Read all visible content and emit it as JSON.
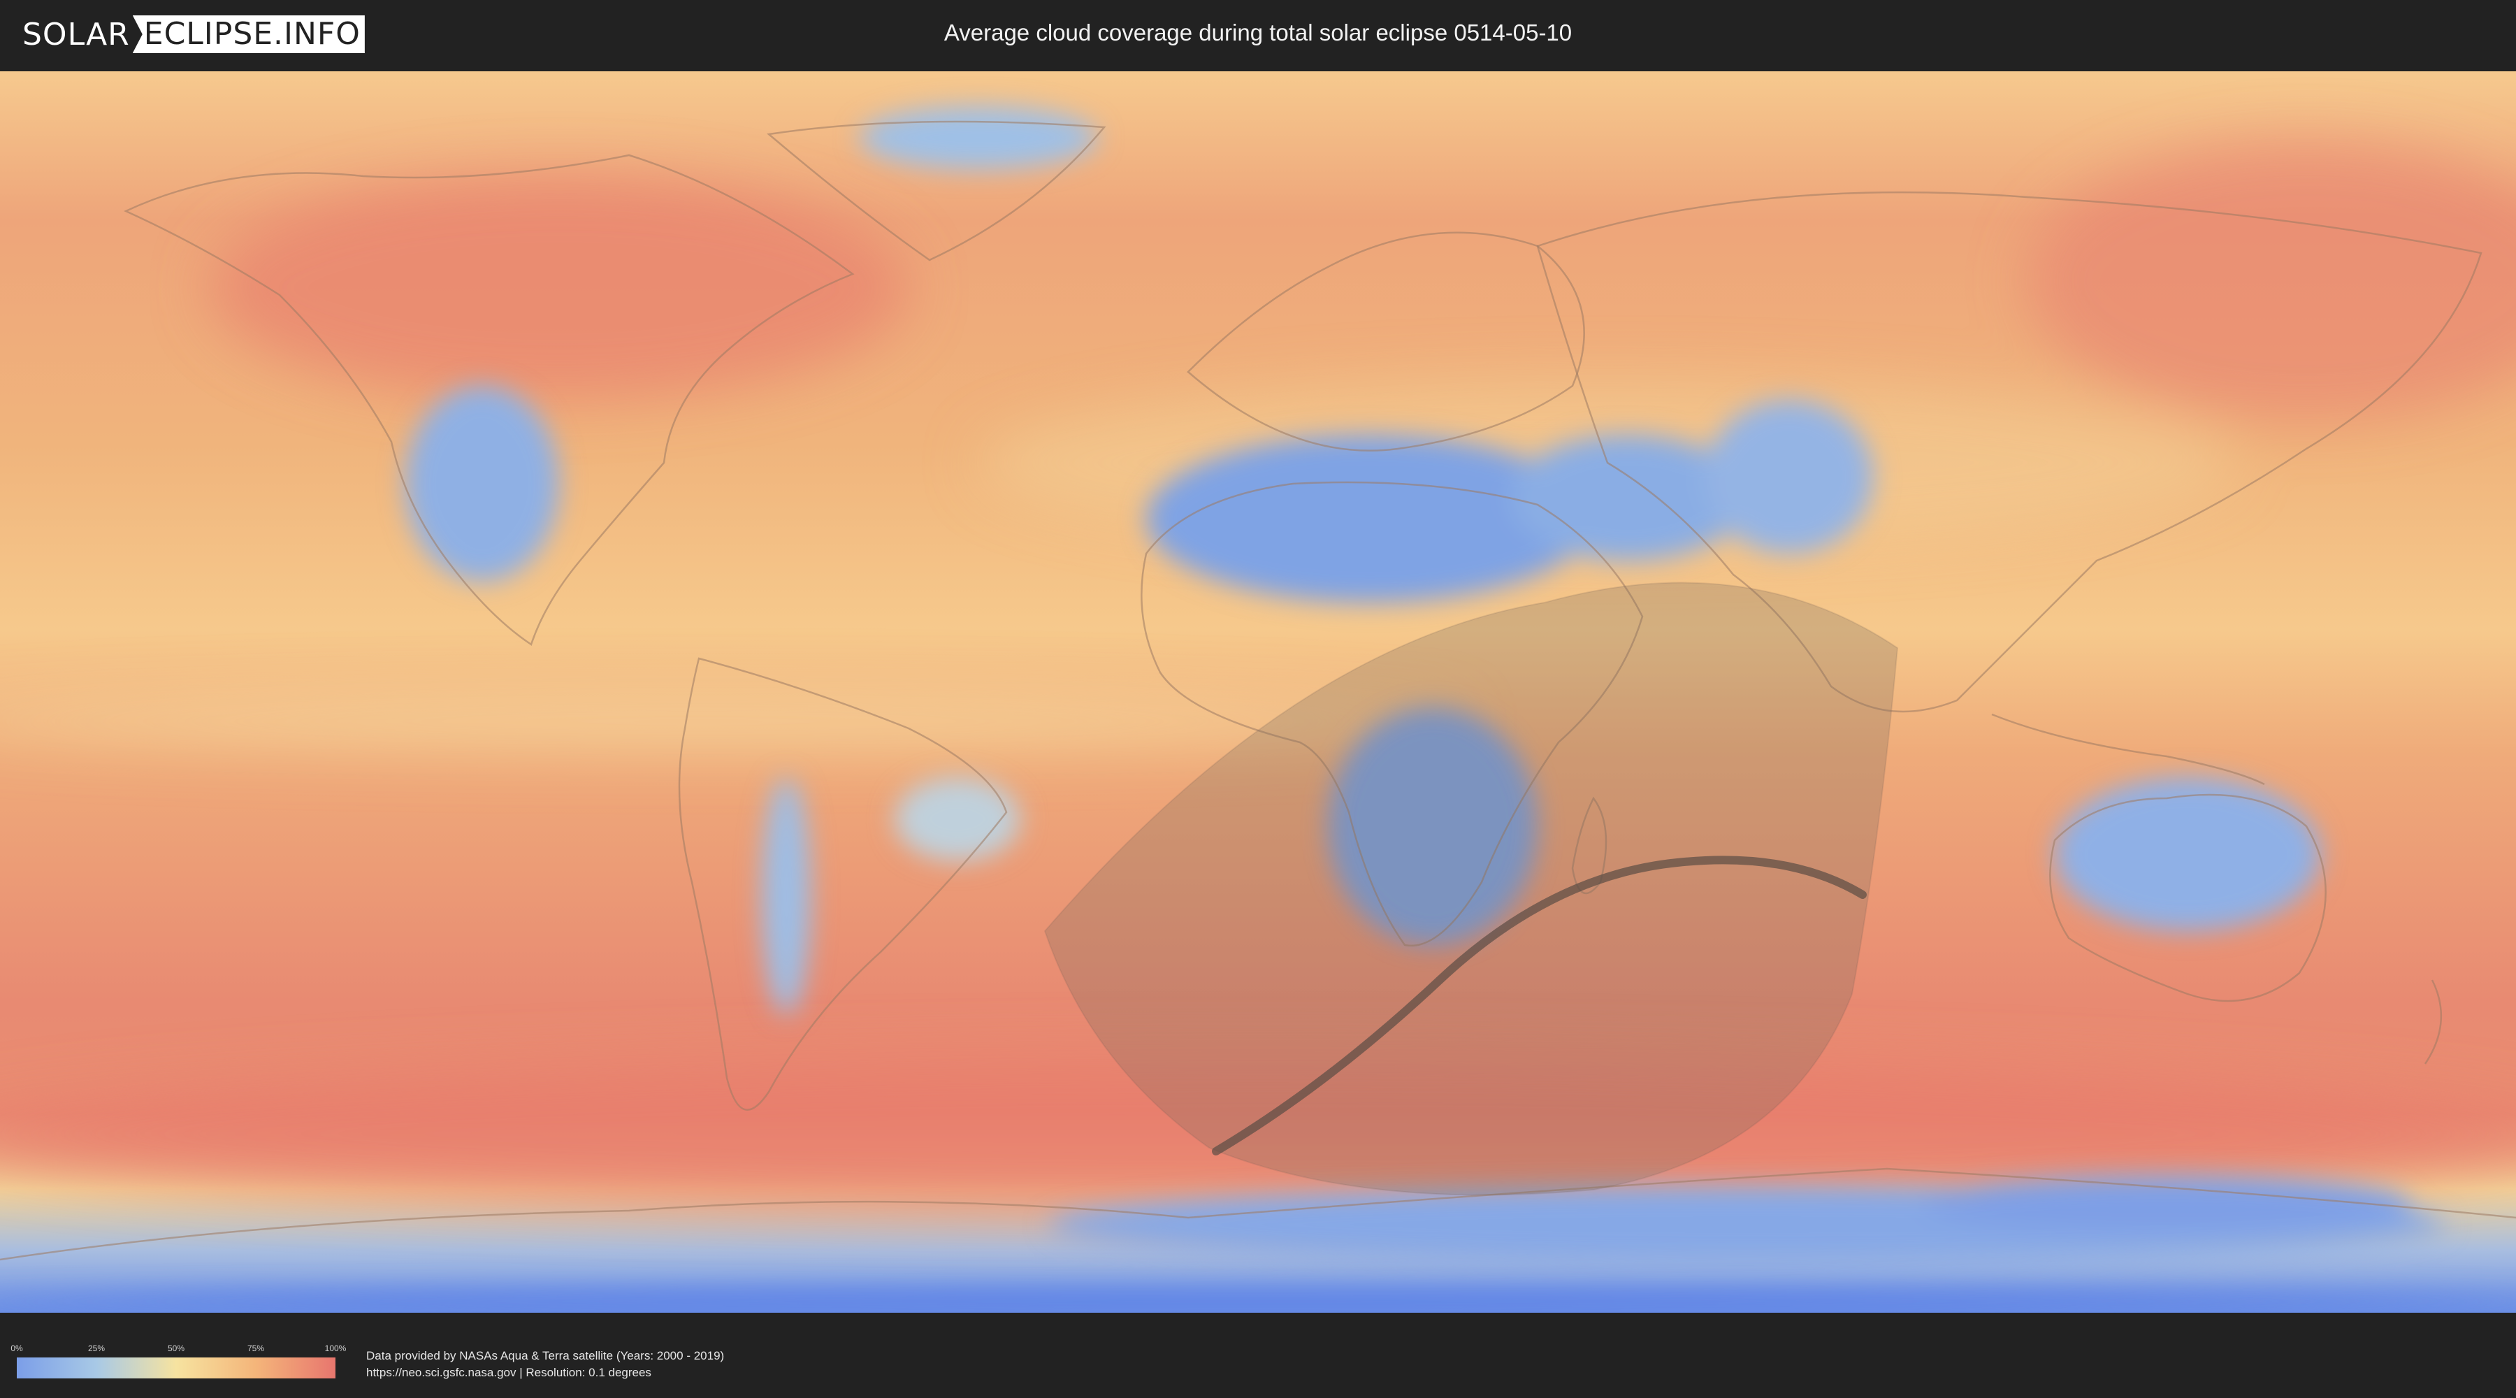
{
  "header": {
    "logo_part1": "SOLAR",
    "logo_part2": "ECLIPSE.INFO",
    "title": "Average cloud coverage during total solar eclipse 0514-05-10"
  },
  "legend": {
    "ticks": [
      "0%",
      "25%",
      "50%",
      "75%",
      "100%"
    ],
    "colors": [
      "#7b9ee8",
      "#a8c9e6",
      "#f6e3a0",
      "#f4b57a",
      "#e8766e"
    ]
  },
  "footer": {
    "credit_line1": "Data provided by NASAs Aqua & Terra satellite (Years: 2000 - 2019)",
    "credit_line2": "https://neo.sci.gsfc.nasa.gov | Resolution: 0.1 degrees"
  },
  "map": {
    "projection": "equirectangular",
    "layers": [
      "cloud-coverage",
      "country-borders",
      "eclipse-visibility-zone",
      "totality-path"
    ]
  }
}
